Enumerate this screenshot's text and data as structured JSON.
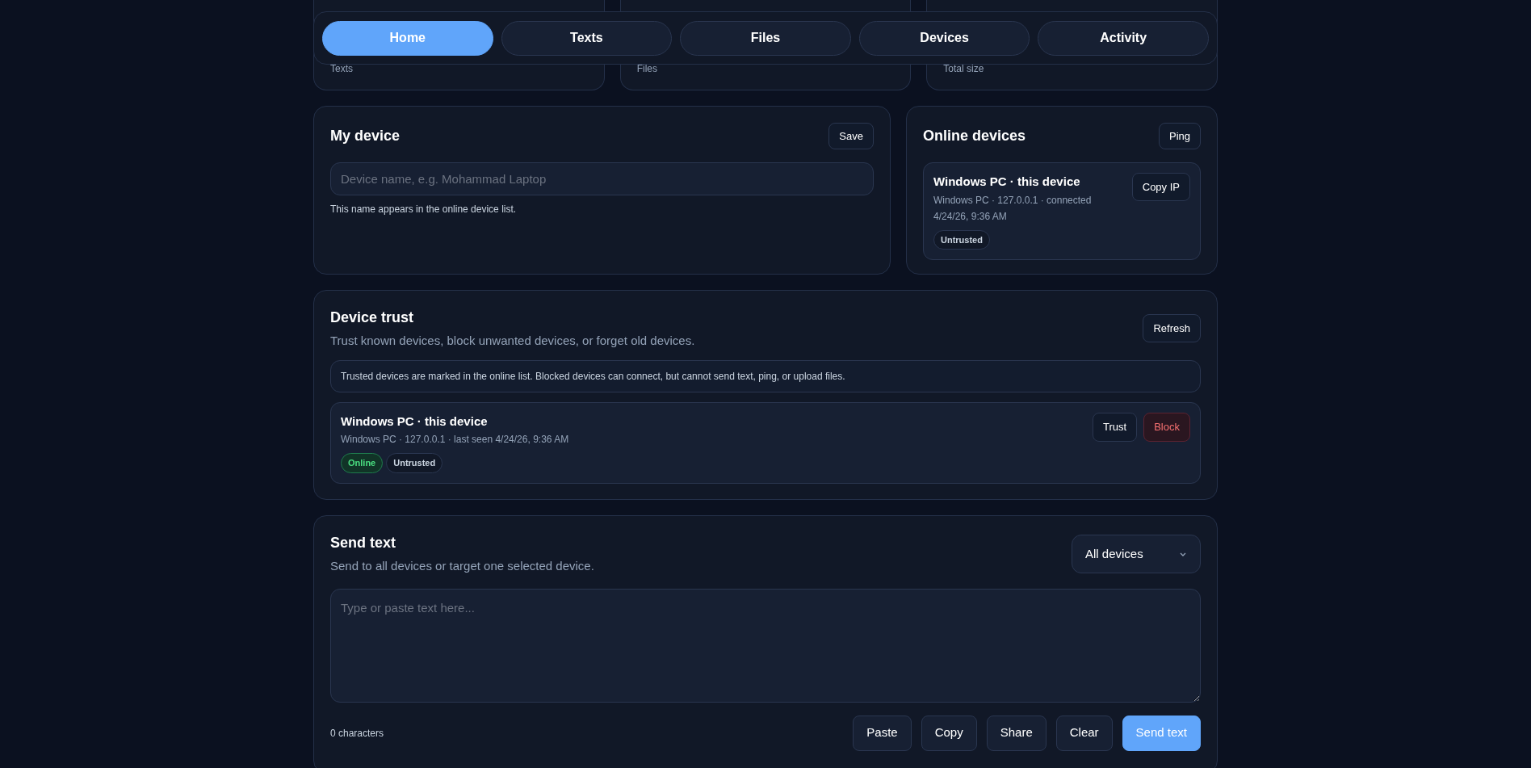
{
  "stats": [
    {
      "label": "Texts"
    },
    {
      "label": "Files"
    },
    {
      "label": "Total size"
    }
  ],
  "nav": {
    "tabs": [
      {
        "label": "Home",
        "selected": true
      },
      {
        "label": "Texts",
        "selected": false
      },
      {
        "label": "Files",
        "selected": false
      },
      {
        "label": "Devices",
        "selected": false
      },
      {
        "label": "Activity",
        "selected": false
      }
    ]
  },
  "my_device": {
    "title": "My device",
    "save_button": "Save",
    "name_field": {
      "placeholder": "Device name, e.g. Mohammad Laptop"
    },
    "hint": "This name appears in the online device list."
  },
  "online_devices": {
    "title": "Online devices",
    "ping_button": "Ping",
    "devices": [
      {
        "name": "Windows PC · this device",
        "details": "Windows PC · 127.0.0.1 · connected",
        "time": "4/24/26, 9:36 AM",
        "button": "Copy IP",
        "badges": [
          {
            "label": "Untrusted",
            "kind": "neutral"
          }
        ]
      }
    ]
  },
  "device_trust": {
    "title": "Device trust",
    "subtitle": "Trust known devices, block unwanted devices, or forget old devices.",
    "refresh_button": "Refresh",
    "notice": "Trusted devices are marked in the online list. Blocked devices can connect, but cannot send text, ping, or upload files.",
    "devices": [
      {
        "name": "Windows PC · this device",
        "details": "Windows PC · 127.0.0.1 · last seen 4/24/26, 9:36 AM",
        "badges": [
          {
            "label": "Online",
            "kind": "success"
          },
          {
            "label": "Untrusted",
            "kind": "neutral"
          }
        ],
        "actions": [
          {
            "label": "Trust",
            "kind": "default"
          },
          {
            "label": "Block",
            "kind": "danger"
          }
        ]
      }
    ]
  },
  "send_text": {
    "title": "Send text",
    "subtitle": "Send to all devices or target one selected device.",
    "target_select": {
      "value": "All devices"
    },
    "message_field": {
      "placeholder": "Type or paste text here..."
    },
    "char_count": "0 characters",
    "buttons": [
      {
        "label": "Paste",
        "kind": "secondary"
      },
      {
        "label": "Copy",
        "kind": "secondary"
      },
      {
        "label": "Share",
        "kind": "secondary"
      },
      {
        "label": "Clear",
        "kind": "secondary"
      },
      {
        "label": "Send text",
        "kind": "primary"
      }
    ]
  }
}
